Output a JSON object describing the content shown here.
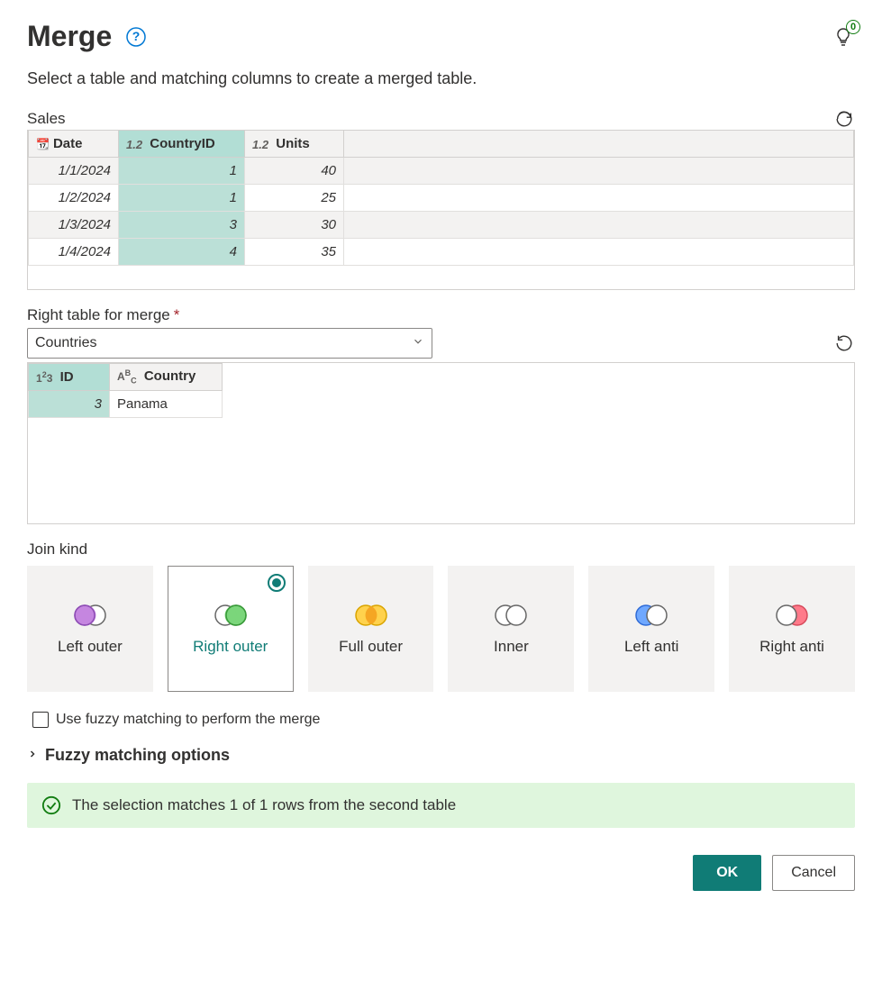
{
  "title": "Merge",
  "subtitle": "Select a table and matching columns to create a merged table.",
  "idea_count": "0",
  "sales": {
    "label": "Sales",
    "columns": {
      "date": "Date",
      "countryId": "CountryID",
      "units": "Units"
    },
    "rows": [
      {
        "date": "1/1/2024",
        "countryId": "1",
        "units": "40"
      },
      {
        "date": "1/2/2024",
        "countryId": "1",
        "units": "25"
      },
      {
        "date": "1/3/2024",
        "countryId": "3",
        "units": "30"
      },
      {
        "date": "1/4/2024",
        "countryId": "4",
        "units": "35"
      }
    ]
  },
  "right_table": {
    "label": "Right table for merge",
    "selected": "Countries",
    "columns": {
      "id": "ID",
      "country": "Country"
    },
    "rows": [
      {
        "id": "3",
        "country": "Panama"
      }
    ]
  },
  "join": {
    "label": "Join kind",
    "options": {
      "left_outer": "Left outer",
      "right_outer": "Right outer",
      "full_outer": "Full outer",
      "inner": "Inner",
      "left_anti": "Left anti",
      "right_anti": "Right anti"
    },
    "selected": "right_outer"
  },
  "fuzzy_checkbox": "Use fuzzy matching to perform the merge",
  "fuzzy_expander": "Fuzzy matching options",
  "status": "The selection matches 1 of 1 rows from the second table",
  "buttons": {
    "ok": "OK",
    "cancel": "Cancel"
  },
  "colors": {
    "teal": "#107c76",
    "success": "#dff6dd"
  }
}
